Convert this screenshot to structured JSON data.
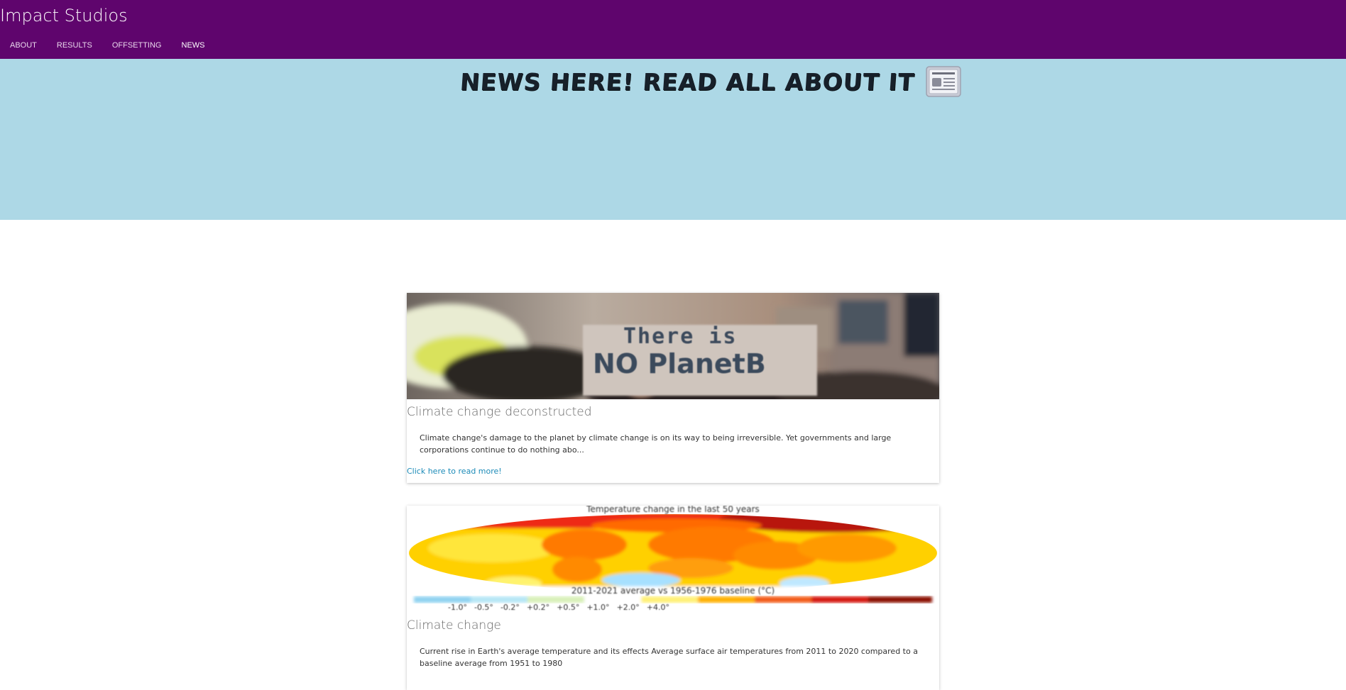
{
  "header": {
    "brand": "Impact Studios",
    "nav": [
      {
        "label": "ABOUT",
        "active": false
      },
      {
        "label": "RESULTS",
        "active": false
      },
      {
        "label": "OFFSETTING",
        "active": false
      },
      {
        "label": "NEWS",
        "active": true
      }
    ],
    "bg_color": "#5f056d"
  },
  "hero": {
    "title": "NEWS HERE! READ ALL ABOUT IT",
    "icon": "newspaper-icon",
    "bg_color": "#add8e6"
  },
  "articles": [
    {
      "image": "protest-sign-photo",
      "image_text_line1": "There is",
      "image_text_line2": "NO PlanetB",
      "title": "Climate change deconstructed",
      "summary": "Climate change's damage to the planet by climate change is on its way to being irreversible. Yet governments and large corporations continue to do nothing abo...",
      "link": "Click here to read more!"
    },
    {
      "image": "temperature-change-map",
      "image_caption_top": "Temperature change in the last 50 years",
      "image_caption_bottom": "2011-2021 average vs 1956-1976 baseline (°C)",
      "image_scale": [
        "-1.0°",
        "-0.5°",
        "-0.2°",
        "+0.2°",
        "+0.5°",
        "+1.0°",
        "+2.0°",
        "+4.0°"
      ],
      "title": "Climate change",
      "summary": "Current rise in Earth's average temperature and its effects Average surface air temperatures from 2011 to 2020 compared to a baseline average from 1951 to 1980"
    }
  ]
}
